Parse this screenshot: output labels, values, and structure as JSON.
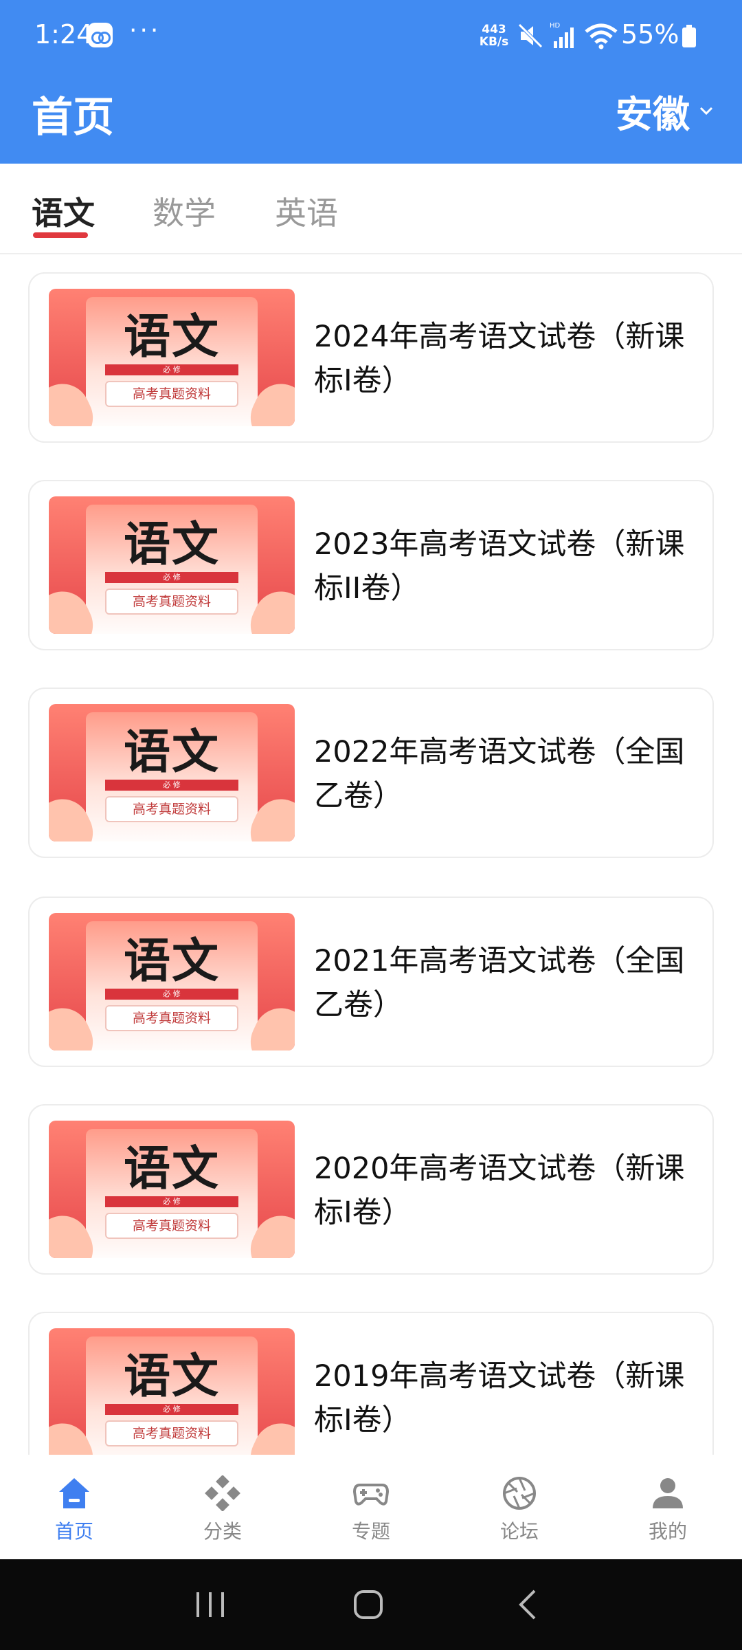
{
  "status_bar": {
    "time": "1:24",
    "more": "···",
    "net_speed_value": "443",
    "net_speed_unit": "KB/s",
    "battery": "55%"
  },
  "header": {
    "title": "首页",
    "region": "安徽"
  },
  "tabs": [
    {
      "label": "语文",
      "active": true
    },
    {
      "label": "数学",
      "active": false
    },
    {
      "label": "英语",
      "active": false
    }
  ],
  "thumbnail": {
    "title": "语文",
    "band": "必 修",
    "caption": "高考真题资料"
  },
  "papers": [
    {
      "title": "2024年高考语文试卷（新课标I卷）"
    },
    {
      "title": "2023年高考语文试卷（新课标II卷）"
    },
    {
      "title": "2022年高考语文试卷（全国乙卷）"
    },
    {
      "title": "2021年高考语文试卷（全国乙卷）"
    },
    {
      "title": "2020年高考语文试卷（新课标I卷）"
    },
    {
      "title": "2019年高考语文试卷（新课标I卷）"
    }
  ],
  "bottom_nav": [
    {
      "label": "首页",
      "icon": "home-icon",
      "active": true
    },
    {
      "label": "分类",
      "icon": "category-icon",
      "active": false
    },
    {
      "label": "专题",
      "icon": "gamepad-icon",
      "active": false
    },
    {
      "label": "论坛",
      "icon": "aperture-icon",
      "active": false
    },
    {
      "label": "我的",
      "icon": "person-icon",
      "active": false
    }
  ],
  "colors": {
    "header_bg": "#418bf2",
    "tab_indicator": "#e0383e",
    "nav_active": "#3f7ff0"
  }
}
